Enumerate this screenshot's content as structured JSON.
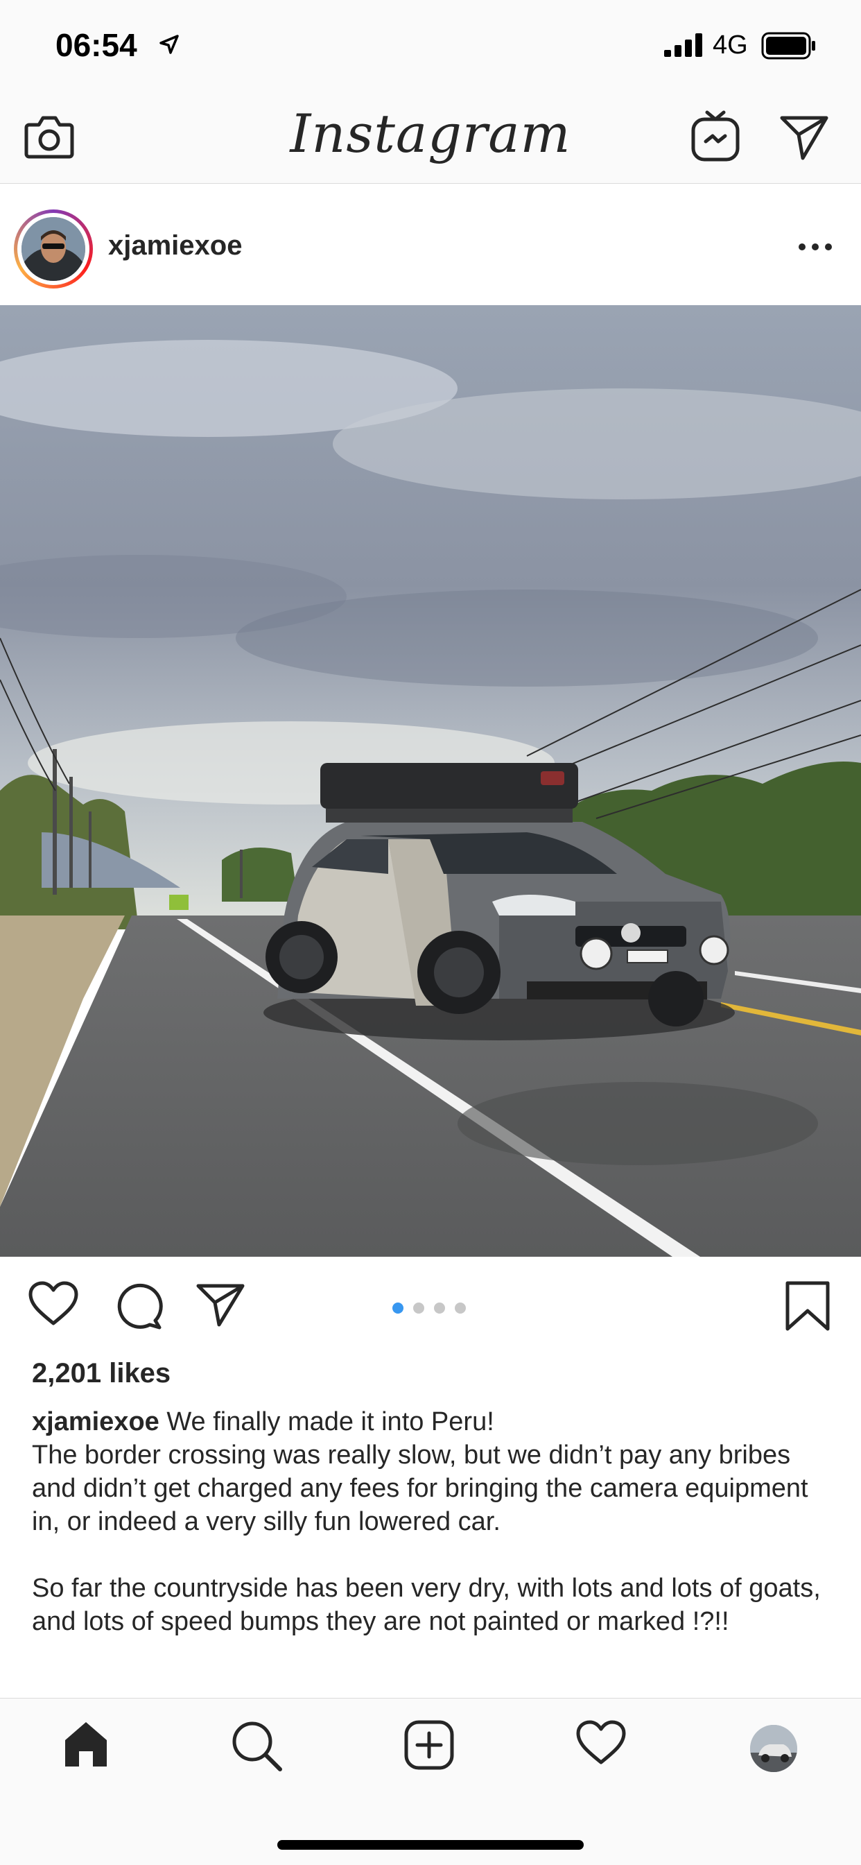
{
  "status_bar": {
    "time": "06:54",
    "network": "4G"
  },
  "header": {
    "logo": "Instagram"
  },
  "post": {
    "username": "xjamiexoe",
    "likes": "2,201 likes",
    "carousel": {
      "count": 4,
      "active_index": 0
    },
    "caption": {
      "username": "xjamiexoe",
      "first_line": "We finally made it into Peru!",
      "paragraph1": "The border crossing was really slow, but we didn’t pay any bribes and didn’t get charged any fees for bringing the camera equipment in, or indeed a very silly fun lowered car.",
      "paragraph2": "So far the countryside has been very dry, with lots and lots of goats, and lots of speed bumps they are not painted or marked !?!!"
    }
  },
  "tab_bar": {
    "items": [
      "home-icon",
      "search-icon",
      "new-post-icon",
      "activity-heart-icon",
      "profile-avatar"
    ],
    "active": "home"
  },
  "colors": {
    "accent": "#3897f0",
    "text": "#262626",
    "bar_bg": "#fafafa",
    "divider": "#dbdbdb"
  }
}
